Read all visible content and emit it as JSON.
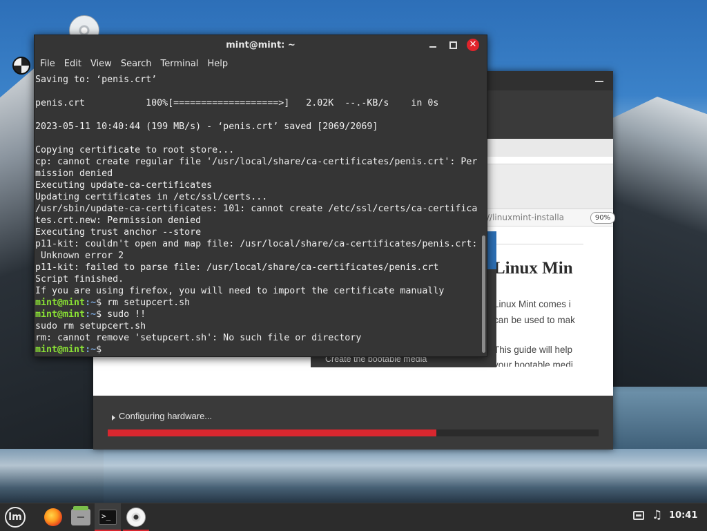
{
  "desktop": {
    "icons": [
      "dvd-icon",
      "disk-icon"
    ]
  },
  "installer": {
    "url_partial": "//linuxmint-installa",
    "zoom": "90%",
    "doc_title": "Linux Min",
    "doc_lines": [
      "Linux Mint comes i",
      "can be used to mak",
      "This guide will help",
      "your bootable medi"
    ],
    "nav_item": "Create the bootable media",
    "status": "Configuring hardware...",
    "progress_percent": 67,
    "accent_color": "#d9272f"
  },
  "terminal": {
    "title": "mint@mint: ~",
    "menu": [
      "File",
      "Edit",
      "View",
      "Search",
      "Terminal",
      "Help"
    ],
    "lines": [
      {
        "text": "Saving to: ‘penis.crt’"
      },
      {
        "text": ""
      },
      {
        "text": "penis.crt           100%[===================>]   2.02K  --.-KB/s    in 0s"
      },
      {
        "text": ""
      },
      {
        "text": "2023-05-11 10:40:44 (199 MB/s) - ‘penis.crt’ saved [2069/2069]"
      },
      {
        "text": ""
      },
      {
        "text": "Copying certificate to root store..."
      },
      {
        "text": "cp: cannot create regular file '/usr/local/share/ca-certificates/penis.crt': Per"
      },
      {
        "text": "mission denied"
      },
      {
        "text": "Executing update-ca-certificates"
      },
      {
        "text": "Updating certificates in /etc/ssl/certs..."
      },
      {
        "text": "/usr/sbin/update-ca-certificates: 101: cannot create /etc/ssl/certs/ca-certifica"
      },
      {
        "text": "tes.crt.new: Permission denied"
      },
      {
        "text": "Executing trust anchor --store"
      },
      {
        "text": "p11-kit: couldn't open and map file: /usr/local/share/ca-certificates/penis.crt:"
      },
      {
        "text": " Unknown error 2"
      },
      {
        "text": "p11-kit: failed to parse file: /usr/local/share/ca-certificates/penis.crt"
      },
      {
        "text": "Script finished."
      },
      {
        "text": "If you are using firefox, you will need to import the certificate manually"
      },
      {
        "user": "mint@mint",
        "path": ":~",
        "cmd": "$ rm setupcert.sh"
      },
      {
        "user": "mint@mint",
        "path": ":~",
        "cmd": "$ sudo !!"
      },
      {
        "text": "sudo rm setupcert.sh"
      },
      {
        "text": "rm: cannot remove 'setupcert.sh': No such file or directory"
      },
      {
        "user": "mint@mint",
        "path": ":~",
        "cmd": "$ "
      }
    ],
    "close_glyph": "✕"
  },
  "taskbar": {
    "menu_logo": "lm",
    "terminal_glyph": ">_",
    "clock": "10:41",
    "tray_icons": [
      "network-icon",
      "music-icon"
    ]
  }
}
